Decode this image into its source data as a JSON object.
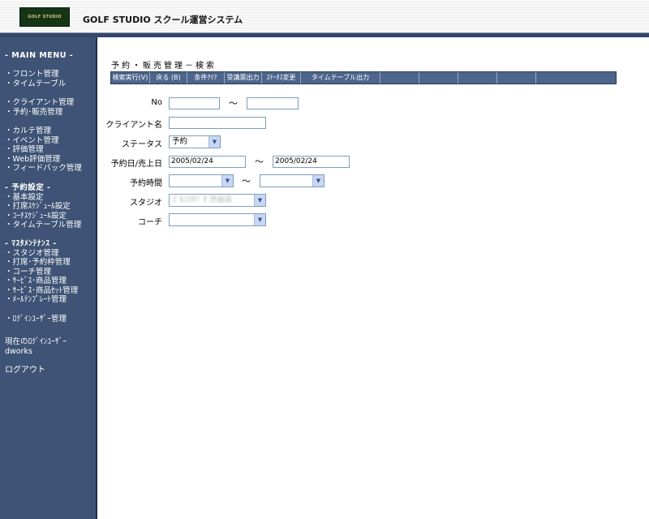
{
  "header": {
    "logo_text": "GOLF STUDIO",
    "app_title": "GOLF STUDIO スクール運営システム"
  },
  "sidebar": {
    "main_menu_heading": "- MAIN MENU -",
    "items": [
      "・フロント管理",
      "・タイムテーブル",
      "・クライアント管理",
      "・予約･販売管理",
      "・カルテ管理",
      "・イベント管理",
      "・評価管理",
      "・Web評価管理",
      "・フィードバック管理"
    ],
    "reservation_settings_heading": "- 予約設定 -",
    "reservation_settings": [
      "・基本設定",
      "・打席ｽｹｼﾞｭｰﾙ設定",
      "・ｺｰﾁｽｹｼﾞｭｰﾙ設定",
      "・タイムテーブル管理"
    ],
    "master_heading": "- ﾏｽﾀﾒﾝﾃﾅﾝｽ -",
    "master_items": [
      "・スタジオ管理",
      "・打席･予約枠管理",
      "・コーチ管理",
      "・ｻｰﾋﾞｽ･商品管理",
      "・ｻｰﾋﾞｽ･商品ｾｯﾄ管理",
      "・ﾒｰﾙﾃﾝﾌﾟﾚｰﾄ管理"
    ],
    "login_user_mgmt": "・ﾛｸﾞｲﾝﾕｰｻﾞｰ管理",
    "current_user_label": "現在のﾛｸﾞｲﾝﾕｰｻﾞｰ",
    "current_user": "dworks",
    "logout": "ログアウト"
  },
  "main": {
    "page_title": "予約・販売管理－検索",
    "toolbar": [
      "検索実行(V)",
      "戻る (B)",
      "条件ｸﾘｱ",
      "受講票出力",
      "ｽﾃｰﾀｽ変更",
      "タイムテーブル出力",
      "",
      "",
      "",
      "",
      ""
    ],
    "form": {
      "no_label": "No",
      "no_from": "",
      "no_to": "",
      "tilde": "～",
      "client_label": "クライアント名",
      "client_value": "",
      "status_label": "ステータス",
      "status_value": "予約",
      "date_label": "予約日/売上日",
      "date_from": "2005/02/24",
      "date_to": "2005/02/24",
      "time_label": "予約時間",
      "time_from": "",
      "time_to": "",
      "studio_label": "スタジオ",
      "studio_value": "ｺﾞﾙﾌｽﾀｼﾞｵ 渋谷店",
      "coach_label": "コーチ",
      "coach_value": ""
    }
  }
}
